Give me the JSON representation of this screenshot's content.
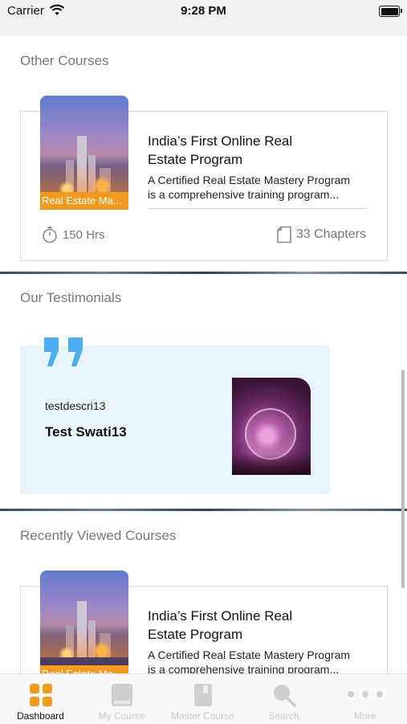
{
  "status_bar": {
    "carrier": "Carrier",
    "time": "9:28 PM"
  },
  "sections": {
    "other_courses": "Other Courses",
    "testimonials": "Our Testimonials",
    "recently_viewed": "Recently Viewed Courses"
  },
  "other_course": {
    "thumbnail_label": "Real Estate Ma...",
    "title_line1": "India’s First Online Real",
    "title_line2": "Estate Program",
    "desc_line1": "A Certified Real Estate Mastery Program",
    "desc_line2": "is a comprehensive training program...",
    "hours": "150 Hrs",
    "chapters": "33 Chapters"
  },
  "testimonial": {
    "description": "testdescri13",
    "name": "Test Swati13"
  },
  "recent_course": {
    "thumbnail_label": "Real Estate Ma...",
    "title_line1": "India’s First Online Real",
    "title_line2": "Estate Program",
    "desc_line1": "A Certified Real Estate Mastery Program",
    "desc_line2": "is a comprehensive training program..."
  },
  "tab_bar": {
    "dashboard": "Dashboard",
    "my_course": "My Course",
    "master_course": "Master Course",
    "search": "Search",
    "more": "More",
    "active": "Dashboard"
  },
  "colors": {
    "accent_orange": "#f39a1e",
    "quote_blue": "#4aaef0",
    "testimonial_bg": "#eaf4fd",
    "inactive_tab": "#c9c9c9"
  },
  "icons": {
    "hours": "stopwatch-icon",
    "chapters": "document-icon",
    "dashboard": "grid-icon",
    "my_course": "book-icon",
    "master_course": "bookmark-book-icon",
    "search": "search-icon",
    "more": "more-dots-icon"
  }
}
